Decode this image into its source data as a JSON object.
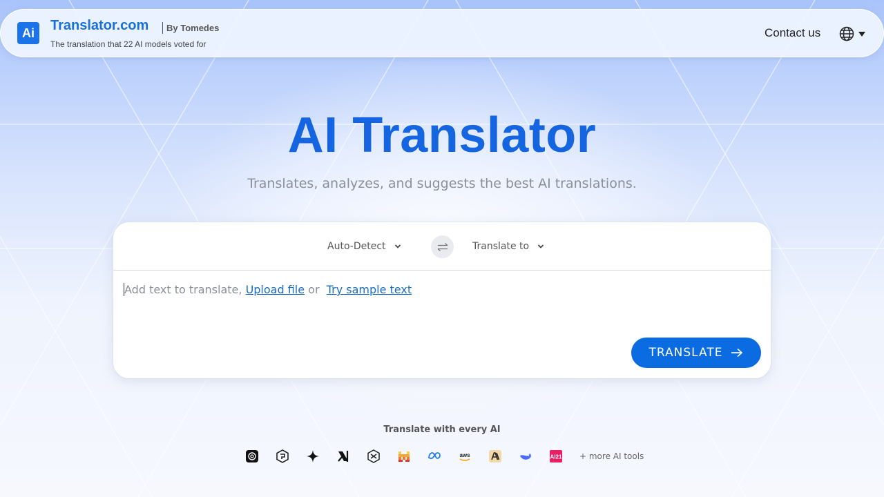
{
  "header": {
    "logo_text": "Ai",
    "brand_name": "Translator.com",
    "brand_by": "By Tomedes",
    "tagline": "The translation that 22 AI models voted for",
    "contact_label": "Contact us",
    "language_icon": "globe-icon"
  },
  "hero": {
    "title": "AI Translator",
    "subtitle": "Translates, analyzes, and suggests the best AI translations."
  },
  "translator": {
    "source_language": "Auto-Detect",
    "target_language": "Translate to",
    "input_placeholder_prefix": "Add text to translate,",
    "upload_link": "Upload file",
    "or_text": "or",
    "sample_link": "Try sample text",
    "translate_button": "TRANSLATE"
  },
  "ai_tools": {
    "caption": "Translate with every AI",
    "icons": [
      "openai-icon",
      "perplexity-icon",
      "gemini-icon",
      "xai-icon",
      "grok-icon",
      "mistral-icon",
      "meta-icon",
      "aws-icon",
      "anthropic-icon",
      "deepseek-icon",
      "ai21-icon"
    ],
    "more_label": "+ more AI tools"
  },
  "colors": {
    "accent": "#1565e0",
    "button": "#0a6ce0",
    "link": "#1a6fc4"
  }
}
